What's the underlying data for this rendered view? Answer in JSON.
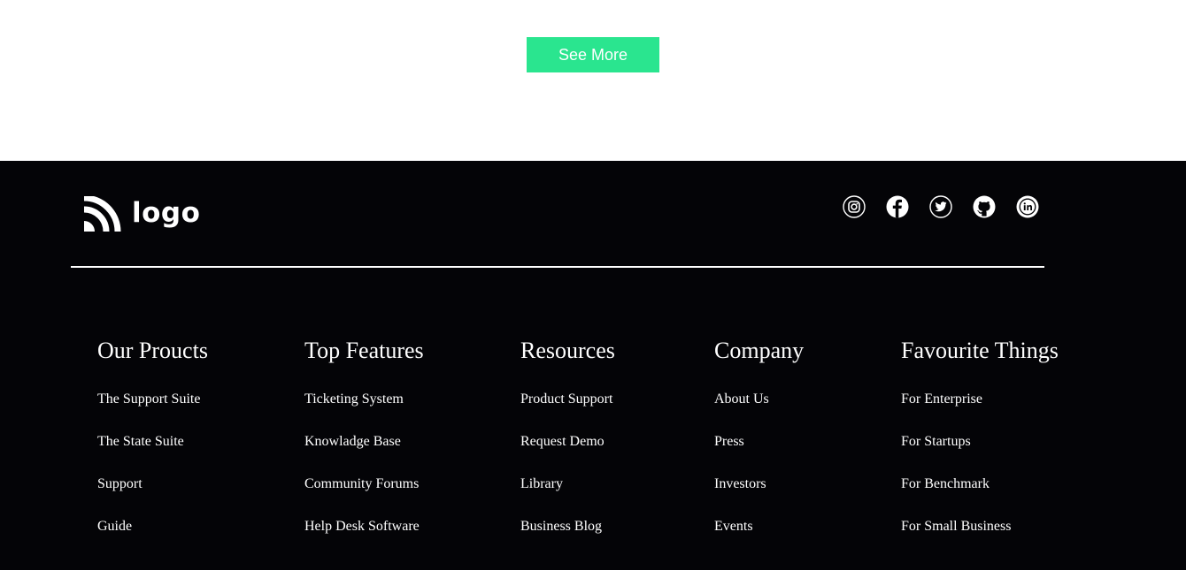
{
  "cta": {
    "see_more_label": "See More",
    "color": "#2ae58f"
  },
  "footer": {
    "background": "#040407",
    "logo_text": "logo",
    "socials": [
      {
        "icon": "instagram-icon"
      },
      {
        "icon": "facebook-icon"
      },
      {
        "icon": "twitter-icon"
      },
      {
        "icon": "github-icon"
      },
      {
        "icon": "linkedin-icon"
      }
    ],
    "columns": [
      {
        "heading": "Our Proucts",
        "links": [
          "The Support Suite",
          "The State Suite",
          "Support",
          "Guide"
        ]
      },
      {
        "heading": "Top Features",
        "links": [
          "Ticketing System",
          "Knowladge Base",
          "Community Forums",
          "Help Desk Software"
        ]
      },
      {
        "heading": "Resources",
        "links": [
          "Product Support",
          "Request Demo",
          "Library",
          "Business Blog"
        ]
      },
      {
        "heading": "Company",
        "links": [
          "About Us",
          "Press",
          "Investors",
          "Events"
        ]
      },
      {
        "heading": "Favourite Things",
        "links": [
          "For Enterprise",
          "For Startups",
          "For Benchmark",
          "For Small Business"
        ]
      }
    ]
  }
}
